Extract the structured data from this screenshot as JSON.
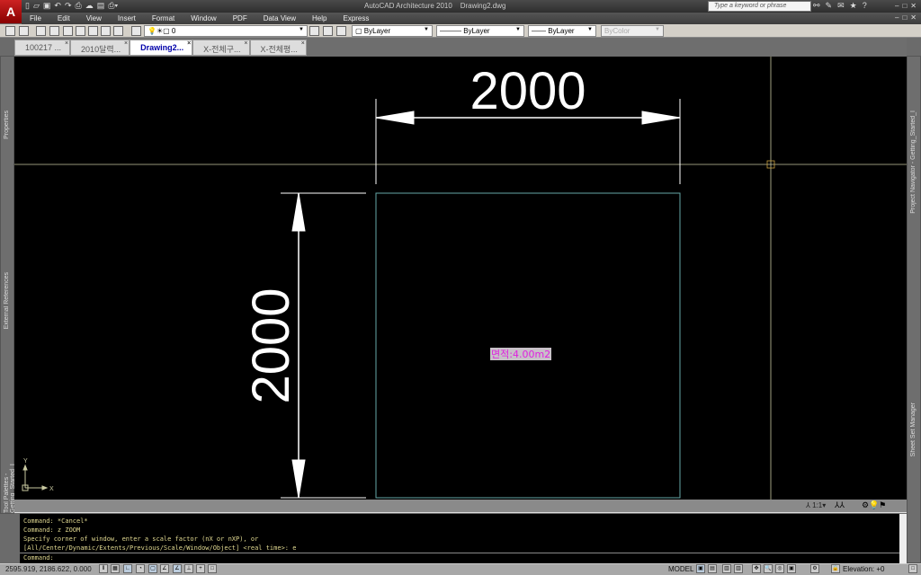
{
  "app": {
    "title": "AutoCAD Architecture 2010",
    "document": "Drawing2.dwg",
    "logo": "A"
  },
  "search": {
    "placeholder": "Type a keyword or phrase"
  },
  "menu": [
    "File",
    "Edit",
    "View",
    "Insert",
    "Format",
    "Window",
    "PDF",
    "Data View",
    "Help",
    "Express"
  ],
  "toolbar": {
    "layer": "0",
    "color": "ByLayer",
    "linetype": "ByLayer",
    "lineweight": "ByLayer",
    "plotstyle": "ByColor"
  },
  "tabs": [
    {
      "label": "100217 ...",
      "active": false
    },
    {
      "label": "2010달력...",
      "active": false
    },
    {
      "label": "Drawing2...",
      "active": true
    },
    {
      "label": "X-전체구...",
      "active": false
    },
    {
      "label": "X-전체평...",
      "active": false
    }
  ],
  "palettes": {
    "left": [
      "Properties",
      "External References",
      "Tool Palettes - Getting_Started_I"
    ],
    "right": [
      "Project Navigator - Getting_Started_I",
      "Sheet Set Manager"
    ]
  },
  "drawing": {
    "dim_horizontal": "2000",
    "dim_vertical": "2000",
    "area_label": "면적",
    "area_value": ":4.00m2",
    "ucs_x": "X",
    "ucs_y": "Y",
    "colors": {
      "rect": "#66a8a8",
      "dim": "#ffffff",
      "crosshair": "#c8c8a0",
      "area": "#e020e0"
    }
  },
  "annotation": {
    "scale": "1:1"
  },
  "command": {
    "history": [
      "Command: *Cancel*",
      "Command: z ZOOM",
      "Specify corner of window, enter a scale factor (nX or nXP), or",
      "[All/Center/Dynamic/Extents/Previous/Scale/Window/Object] <real time>: e"
    ],
    "prompt": "Command:"
  },
  "status": {
    "coords": "2595.919, 2186.622, 0.000",
    "space": "MODEL",
    "elevation": "Elevation: +0"
  }
}
